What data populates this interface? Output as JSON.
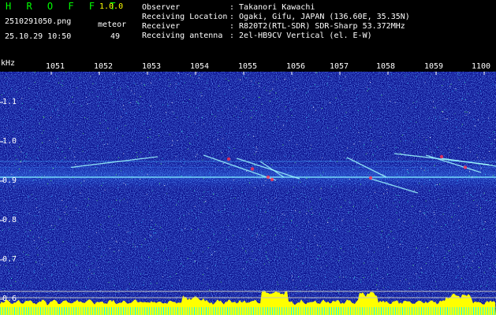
{
  "header": {
    "app_title": "H R O F F T",
    "app_version": "1.0.0",
    "file_name": "2510291050.png",
    "meteor_label": "meteor",
    "date_time": "25.10.29 10:50",
    "meteor_count": "49",
    "info": [
      {
        "key": "Observer",
        "value": ": Takanori Kawachi"
      },
      {
        "key": "Receiving Location",
        "value": ": Ogaki, Gifu, JAPAN (136.60E, 35.35N)"
      },
      {
        "key": "Receiver",
        "value": ": R820T2(RTL-SDR) SDR-Sharp 53.372MHz"
      },
      {
        "key": "Receiving antenna",
        "value": ": 2el-HB9CV Vertical (el. E-W)"
      }
    ]
  },
  "axis": {
    "unit": "kHz",
    "time_ticks": [
      "1051",
      "1052",
      "1053",
      "1054",
      "1055",
      "1056",
      "1057",
      "1058",
      "1059",
      "1100"
    ],
    "freq_ticks": [
      "1.1",
      "1.0",
      "0.9",
      "0.8",
      "0.7",
      "0.6"
    ],
    "freq_values": [
      1.1,
      1.0,
      0.9,
      0.8,
      0.7,
      0.6
    ]
  },
  "colors": {
    "background": "#000000",
    "spectrum_base": "#0a0e8c",
    "title": "#00ff00",
    "version": "#ffff00",
    "text": "#ffffff",
    "signal": "#ffff00",
    "baseline": "#00ffff"
  }
}
